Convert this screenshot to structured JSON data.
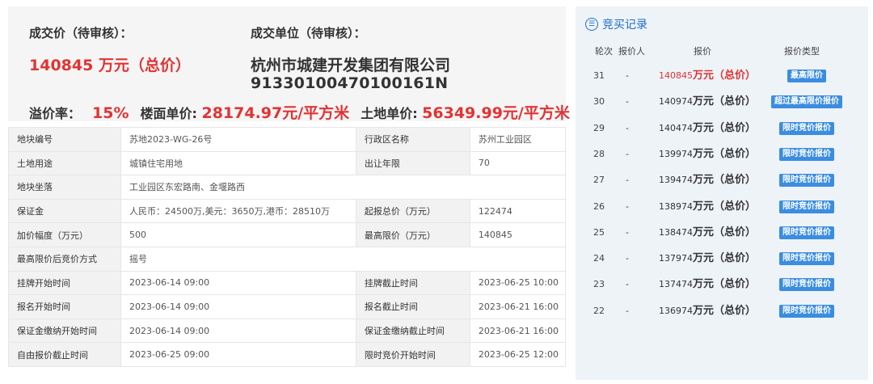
{
  "summary": {
    "deal_price_label": "成交价（待审核）：",
    "deal_price": "140845 万元（总价）",
    "deal_unit_label": "成交单位（待审核）：",
    "deal_unit_name": "杭州市城建开发集团有限公司",
    "deal_unit_code": "91330100470100161N",
    "premium_label": "溢价率：",
    "premium_value": "15%",
    "floor_price_label": "楼面单价:",
    "floor_price_value": "28174.97元/平方米",
    "land_price_label": "土地单价:",
    "land_price_value": "56349.99元/平方米"
  },
  "info": {
    "r1": {
      "k1": "地块编号",
      "v1": "苏地2023-WG-26号",
      "k2": "行政区名称",
      "v2": "苏州工业园区"
    },
    "r2": {
      "k1": "土地用途",
      "v1": "城镇住宅用地",
      "k2": "出让年限",
      "v2": "70"
    },
    "r3": {
      "k1": "地块坐落",
      "v1": "工业园区东宏路南、金堰路西"
    },
    "r4": {
      "k1": "保证金",
      "v1": "人民币：24500万,美元：3650万,港币：28510万",
      "k2": "起报总价（万元）",
      "v2": "122474"
    },
    "r5": {
      "k1": "加价幅度（万元）",
      "v1": "500",
      "k2": "最高限价（万元）",
      "v2": "140845"
    },
    "r6": {
      "k1": "最高限价后竞价方式",
      "v1": "摇号"
    },
    "r7": {
      "k1": "挂牌开始时间",
      "v1": "2023-06-14 09:00",
      "k2": "挂牌截止时间",
      "v2": "2023-06-25 10:00"
    },
    "r8": {
      "k1": "报名开始时间",
      "v1": "2023-06-14 09:00",
      "k2": "报名截止时间",
      "v2": "2023-06-21 16:00"
    },
    "r9": {
      "k1": "保证金缴纳开始时间",
      "v1": "2023-06-14 09:00",
      "k2": "保证金缴纳截止时间",
      "v2": "2023-06-21 16:00"
    },
    "r10": {
      "k1": "自由报价截止时间",
      "v1": "2023-06-25 09:00",
      "k2": "限时竞价开始时间",
      "v2": "2023-06-25 12:00"
    }
  },
  "records": {
    "title": "竞买记录",
    "icon": "auction-record-icon",
    "headers": {
      "round": "轮次",
      "bidder": "报价人",
      "price": "报价",
      "type": "报价类型"
    },
    "rows": [
      {
        "round": "31",
        "bidder": "-",
        "num": "140845",
        "unit": "万元（总价）",
        "type": "最高限价"
      },
      {
        "round": "30",
        "bidder": "-",
        "num": "140974",
        "unit": "万元（总价）",
        "type": "超过最高限价报价"
      },
      {
        "round": "29",
        "bidder": "-",
        "num": "140474",
        "unit": "万元（总价）",
        "type": "限时竞价报价"
      },
      {
        "round": "28",
        "bidder": "-",
        "num": "139974",
        "unit": "万元（总价）",
        "type": "限时竞价报价"
      },
      {
        "round": "27",
        "bidder": "-",
        "num": "139474",
        "unit": "万元（总价）",
        "type": "限时竞价报价"
      },
      {
        "round": "26",
        "bidder": "-",
        "num": "138974",
        "unit": "万元（总价）",
        "type": "限时竞价报价"
      },
      {
        "round": "25",
        "bidder": "-",
        "num": "138474",
        "unit": "万元（总价）",
        "type": "限时竞价报价"
      },
      {
        "round": "24",
        "bidder": "-",
        "num": "137974",
        "unit": "万元（总价）",
        "type": "限时竞价报价"
      },
      {
        "round": "23",
        "bidder": "-",
        "num": "137474",
        "unit": "万元（总价）",
        "type": "限时竞价报价"
      },
      {
        "round": "22",
        "bidder": "-",
        "num": "136974",
        "unit": "万元（总价）",
        "type": "限时竞价报价"
      }
    ]
  },
  "colors": {
    "accent_red": "#e23333",
    "badge_blue": "#3b8de0",
    "title_blue": "#1f6fc9"
  }
}
